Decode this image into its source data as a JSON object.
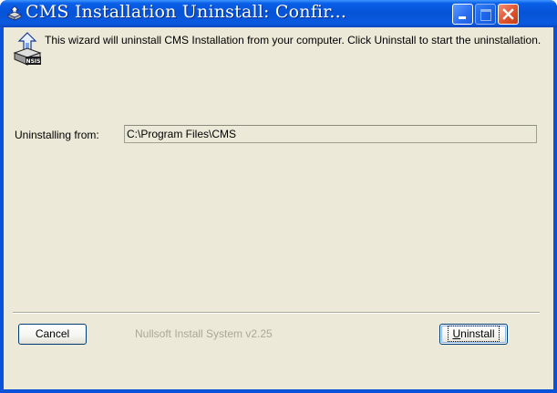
{
  "window": {
    "title": "CMS Installation Uninstall: Confir...",
    "icons": {
      "app": "nsis-setup-icon",
      "minimize": "minimize-icon",
      "maximize": "maximize-icon",
      "close": "close-icon"
    }
  },
  "header": {
    "icon": "nsis-installer-icon",
    "intro_text": "This wizard will uninstall CMS Installation from your computer. Click Uninstall to start the uninstallation."
  },
  "location": {
    "label": "Uninstalling from:",
    "value": "C:\\Program Files\\CMS"
  },
  "footer": {
    "cancel_label": "Cancel",
    "brand_text": "Nullsoft Install System v2.25",
    "uninstall_label": "Uninstall",
    "uninstall_accelerator": "U"
  },
  "colors": {
    "titlebar": "#0553d6",
    "client_bg": "#ece9d8",
    "close_button": "#e0532f",
    "disabled_text": "#aca899"
  }
}
